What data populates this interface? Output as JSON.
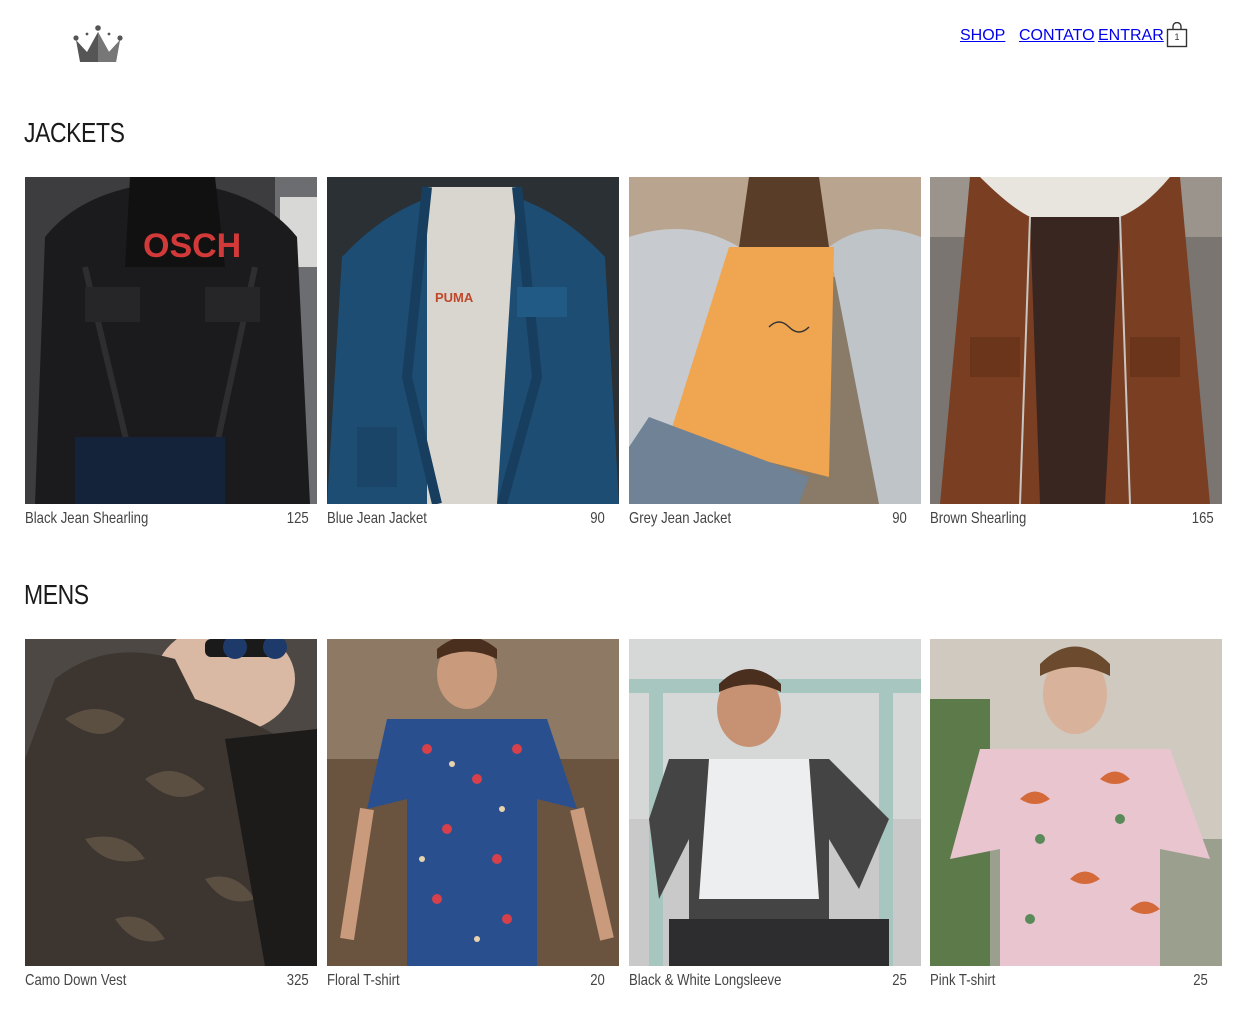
{
  "header": {
    "logo_icon": "crown-icon",
    "nav": [
      {
        "label": "SHOP"
      },
      {
        "label": "CONTATO"
      },
      {
        "label": "ENTRAR"
      }
    ],
    "cart": {
      "icon": "shopping-bag-icon",
      "count": "1"
    }
  },
  "sections": [
    {
      "title": "JACKETS",
      "products": [
        {
          "name": "Black Jean Shearling",
          "price": "125"
        },
        {
          "name": "Blue Jean Jacket",
          "price": "90"
        },
        {
          "name": "Grey Jean Jacket",
          "price": "90"
        },
        {
          "name": "Brown Shearling",
          "price": "165"
        }
      ]
    },
    {
      "title": "MENS",
      "products": [
        {
          "name": "Camo Down Vest",
          "price": "325"
        },
        {
          "name": "Floral T-shirt",
          "price": "20"
        },
        {
          "name": "Black & White Longsleeve",
          "price": "25"
        },
        {
          "name": "Pink T-shirt",
          "price": "25"
        }
      ]
    }
  ]
}
